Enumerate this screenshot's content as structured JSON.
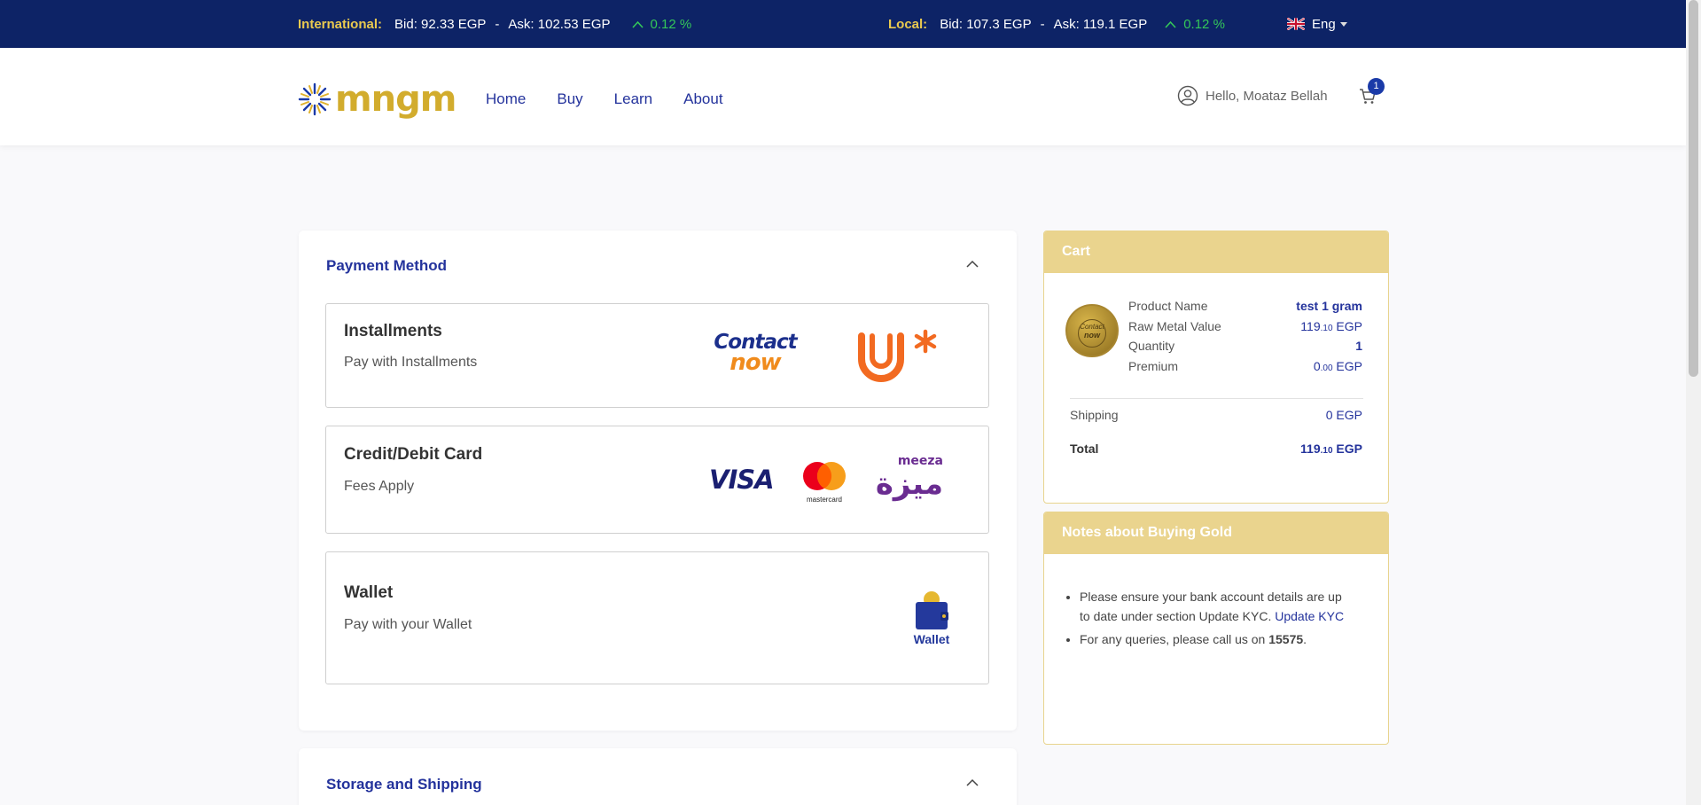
{
  "ticker": {
    "international": {
      "label": "International:",
      "bid": "Bid: 92.33 EGP",
      "ask": "Ask: 102.53 EGP",
      "change": "0.12 %"
    },
    "local": {
      "label": "Local:",
      "bid": "Bid: 107.3 EGP",
      "ask": "Ask: 119.1 EGP",
      "change": "0.12 %"
    },
    "separator": "-",
    "language": "Eng"
  },
  "header": {
    "logo_text": "mngm",
    "nav": [
      "Home",
      "Buy",
      "Learn",
      "About"
    ],
    "greeting": "Hello, Moataz Bellah",
    "cart_count": "1"
  },
  "payment": {
    "title": "Payment Method",
    "options": [
      {
        "title": "Installments",
        "subtitle": "Pay with Installments",
        "logos": [
          "contact-now",
          "valu"
        ]
      },
      {
        "title": "Credit/Debit Card",
        "subtitle": "Fees Apply",
        "logos": [
          "visa",
          "mastercard",
          "meeza"
        ]
      },
      {
        "title": "Wallet",
        "subtitle": "Pay with your Wallet",
        "logos": [
          "wallet"
        ]
      }
    ]
  },
  "logo_text": {
    "contact": "Contact",
    "now": "now",
    "visa": "VISA",
    "mastercard": "mastercard",
    "meeza_en": "meeza",
    "meeza_ar": "ميزة",
    "wallet": "Wallet"
  },
  "storage": {
    "title": "Storage and Shipping"
  },
  "cart": {
    "title": "Cart",
    "product_name_label": "Product Name",
    "product_name": "test 1 gram",
    "raw_metal_label": "Raw Metal Value",
    "raw_metal_int": "119",
    "raw_metal_dec": ".10",
    "currency": " EGP",
    "quantity_label": "Quantity",
    "quantity": "1",
    "premium_label": "Premium",
    "premium_int": "0",
    "premium_dec": ".00",
    "shipping_label": "Shipping",
    "shipping": "0 EGP",
    "total_label": "Total",
    "total_int": "119",
    "total_dec": ".10",
    "coin_text_1": "Contact",
    "coin_text_2": "now"
  },
  "notes": {
    "title": "Notes about Buying Gold",
    "item1": "Please ensure your bank account details are up to date under section Update KYC.",
    "item1_link": "Update KYC",
    "item2_prefix": "For any queries, please call us on ",
    "item2_number": "15575",
    "item2_suffix": "."
  },
  "colors": {
    "navy": "#0d2366",
    "gold": "#d2ac2d",
    "link_blue": "#24339c",
    "positive_green": "#34c759",
    "side_header": "#ead48e"
  }
}
